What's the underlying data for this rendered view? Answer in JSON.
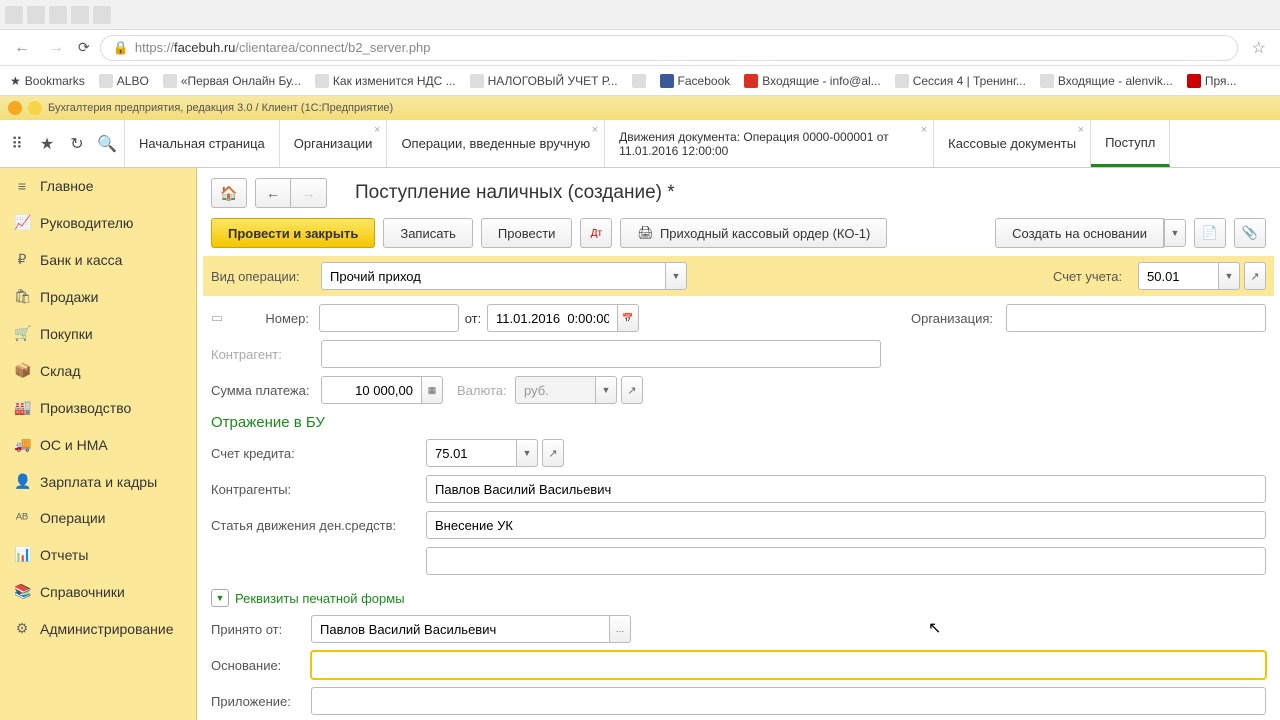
{
  "browser": {
    "url_prefix": "https://",
    "url_domain": "facebuh.ru",
    "url_path": "/clientarea/connect/b2_server.php"
  },
  "bookmarks": {
    "label": "Bookmarks",
    "items": [
      "ALBO",
      "«Первая Онлайн Бу...",
      "Как изменится НДС ...",
      "НАЛОГОВЫЙ УЧЕТ Р...",
      "Facebook",
      "Входящие - info@al...",
      "Сессия 4 | Тренинг...",
      "Входящие - alenvik...",
      "Пря..."
    ]
  },
  "app_title": "Бухгалтерия предприятия, редакция 3.0 / Клиент  (1С:Предприятие)",
  "tabs": {
    "items": [
      {
        "label": "Начальная страница",
        "closable": false
      },
      {
        "label": "Организации",
        "closable": true
      },
      {
        "label": "Операции, введенные вручную",
        "closable": true
      },
      {
        "label": "Движения документа: Операция 0000-000001 от 11.01.2016 12:00:00",
        "closable": true,
        "multiline": true
      },
      {
        "label": "Кассовые документы",
        "closable": true
      },
      {
        "label": "Поступл",
        "closable": false,
        "active": true
      }
    ]
  },
  "sidebar": {
    "items": [
      {
        "icon": "≡",
        "label": "Главное"
      },
      {
        "icon": "📈",
        "label": "Руководителю"
      },
      {
        "icon": "₽",
        "label": "Банк и касса"
      },
      {
        "icon": "🛍",
        "label": "Продажи"
      },
      {
        "icon": "🛒",
        "label": "Покупки"
      },
      {
        "icon": "📦",
        "label": "Склад"
      },
      {
        "icon": "🏭",
        "label": "Производство"
      },
      {
        "icon": "🚚",
        "label": "ОС и НМА"
      },
      {
        "icon": "👤",
        "label": "Зарплата и кадры"
      },
      {
        "icon": "ᴬᴮ",
        "label": "Операции"
      },
      {
        "icon": "📊",
        "label": "Отчеты"
      },
      {
        "icon": "📚",
        "label": "Справочники"
      },
      {
        "icon": "⚙",
        "label": "Администрирование"
      }
    ]
  },
  "page": {
    "title": "Поступление наличных (создание) *",
    "toolbar": {
      "primary": "Провести и закрыть",
      "save": "Записать",
      "post": "Провести",
      "print": "Приходный кассовый ордер (КО-1)",
      "create_based": "Создать на основании"
    },
    "form": {
      "op_type_label": "Вид операции:",
      "op_type_value": "Прочий приход",
      "account_label": "Счет учета:",
      "account_value": "50.01",
      "number_label": "Номер:",
      "from_label": "от:",
      "date_value": "11.01.2016  0:00:00",
      "org_label": "Организация:",
      "contragent_label": "Контрагент:",
      "amount_label": "Сумма платежа:",
      "amount_value": "10 000,00",
      "currency_label": "Валюта:",
      "currency_value": "руб.",
      "section_bu": "Отражение в БУ",
      "credit_label": "Счет кредита:",
      "credit_value": "75.01",
      "contragents_label": "Контрагенты:",
      "contragents_value": "Павлов Василий Васильевич",
      "dds_label": "Статья движения ден.средств:",
      "dds_value": "Внесение УК",
      "print_section": "Реквизиты печатной формы",
      "received_label": "Принято от:",
      "received_value": "Павлов Василий Васильевич",
      "basis_label": "Основание:",
      "attachment_label": "Приложение:"
    }
  }
}
